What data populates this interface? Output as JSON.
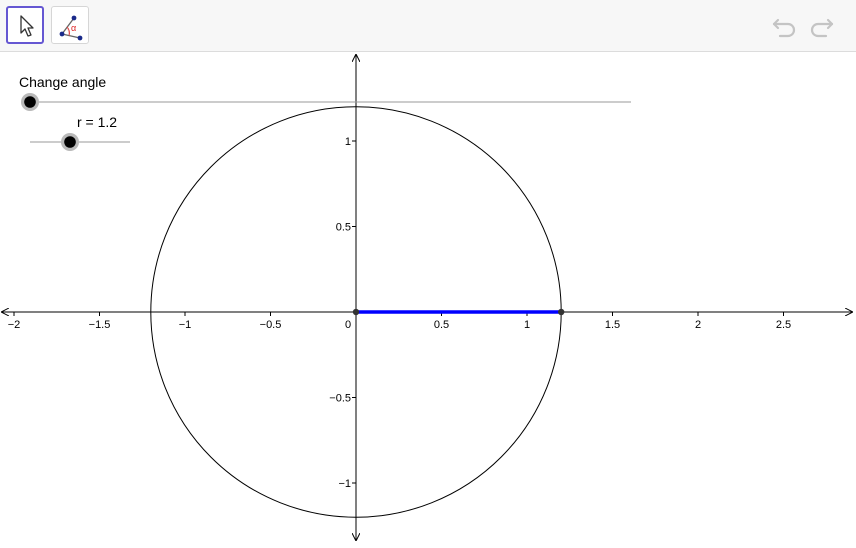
{
  "toolbar": {
    "tools": [
      {
        "name": "move-tool",
        "icon": "arrow-cursor-icon",
        "active": true
      },
      {
        "name": "angle-tool",
        "icon": "angle-icon",
        "active": false,
        "glyph": "α"
      }
    ],
    "undo_icon": "undo-icon",
    "redo_icon": "redo-icon"
  },
  "sliders": {
    "angle": {
      "caption": "Change angle",
      "value_fraction": 0.0
    },
    "radius": {
      "caption": "r = 1.2",
      "value": 1.2,
      "min": 0,
      "max": 3
    }
  },
  "axes": {
    "x_ticks": [
      "−2",
      "−1.5",
      "−1",
      "−0.5",
      "0",
      "0.5",
      "1",
      "1.5",
      "2",
      "2.5"
    ],
    "y_ticks": [
      "1",
      "0.5",
      "−0.5",
      "−1"
    ]
  },
  "figure": {
    "circle_radius": 1.2,
    "segment": {
      "from": [
        0,
        0
      ],
      "to": [
        1.2,
        0
      ]
    },
    "segment_color": "#0000ff",
    "point_color": "#333333"
  }
}
